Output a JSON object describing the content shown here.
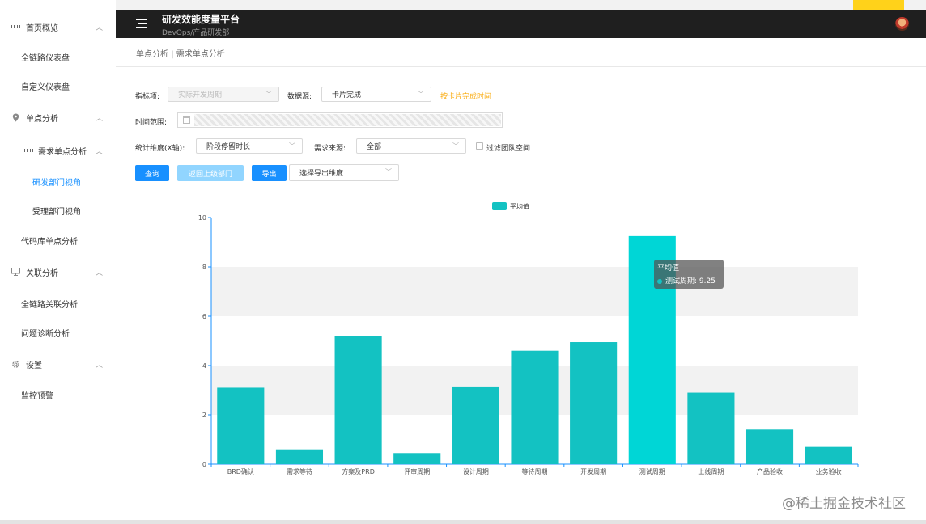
{
  "sidebar": {
    "groups": [
      {
        "label": "首页概览",
        "icon": "grid-icon",
        "items": [
          {
            "label": "全链路仪表盘"
          },
          {
            "label": "自定义仪表盘"
          }
        ]
      },
      {
        "label": "单点分析",
        "icon": "map-pin-icon"
      },
      {
        "label": "需求单点分析",
        "icon": "grid-icon",
        "items": [
          {
            "label": "研发部门视角",
            "active": true
          },
          {
            "label": "受理部门视角"
          }
        ]
      },
      {
        "label": "代码库单点分析"
      },
      {
        "label": "关联分析",
        "icon": "monitor-icon",
        "items": [
          {
            "label": "全链路关联分析"
          },
          {
            "label": "问题诊断分析"
          }
        ]
      },
      {
        "label": "设置",
        "icon": "gear-icon",
        "items": [
          {
            "label": "监控预警"
          }
        ]
      }
    ]
  },
  "header": {
    "title": "研发效能度量平台",
    "subtitle": "DevOps/产品研发部"
  },
  "breadcrumb": "单点分析 | 需求单点分析",
  "filters": {
    "metric_label": "指标项:",
    "metric_value": "实际开发周期",
    "datasource_label": "数据源:",
    "datasource_value": "卡片完成",
    "datasource_link": "按卡片完成时间",
    "time_label": "时间范围:",
    "dimension_label": "统计维度(X轴):",
    "dimension_value": "阶段停留时长",
    "source_label": "需求来源:",
    "source_value": "全部",
    "filter_team_label": "过滤团队空间",
    "query_button": "查询",
    "back_button": "返回上级部门",
    "export_button": "导出",
    "export_select": "选择导出维度"
  },
  "chart_data": {
    "type": "bar",
    "legend": [
      "平均值"
    ],
    "legend_position": "top-center",
    "color": "#13c2c2",
    "highlight_color": "#00d6d6",
    "categories": [
      "BRD确认",
      "需求等待",
      "方案及PRD",
      "评审周期",
      "设计周期",
      "等待周期",
      "开发周期",
      "测试周期",
      "上线周期",
      "产品验收",
      "业务验收"
    ],
    "series": [
      {
        "name": "平均值",
        "values": [
          3.1,
          0.6,
          5.2,
          0.45,
          3.15,
          4.6,
          4.95,
          9.25,
          2.9,
          1.4,
          0.7
        ]
      }
    ],
    "ylim": [
      0,
      10
    ],
    "yticks": [
      0,
      2,
      4,
      6,
      8,
      10
    ],
    "grid": "alternating bands",
    "highlighted_index": 7,
    "tooltip": {
      "title": "平均值",
      "text": "测试周期: 9.25"
    }
  },
  "watermark": "@稀土掘金技术社区"
}
